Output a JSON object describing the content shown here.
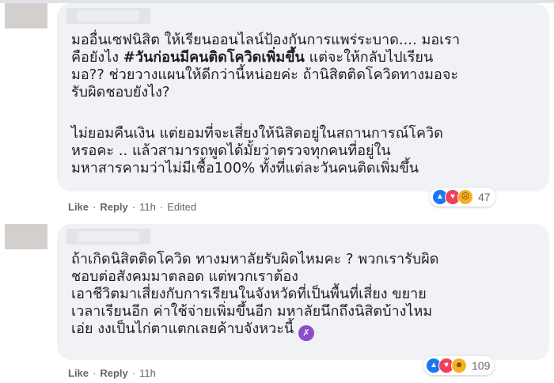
{
  "comments": [
    {
      "author": "",
      "paragraph1": {
        "before": "มออื่นเซฟนิสิต ให้เรียนออนไลน์ป้องกันการแพร่ระบาด.... มอเรา\nคือยังไง ",
        "hashtag": "#วันก่อนมีคนติดโควิดเพิ่มขึ้น",
        "after": " แต่จะให้กลับไปเรียน\nมอ?? ช่วยวางแผนให้ดีกว่านี้หน่อยค่ะ ถ้านิสิตติดโควิดทางมอจะ\nรับผิดชอบยังไง?"
      },
      "paragraph2": "ไม่ยอมคืนเงิน แต่ยอมที่จะเสี่ยงให้นิสิตอยู่ในสถานการณ์โควิด\nหรอคะ .. แล้วสามารถพูดได้มั้ยว่าตรวจทุกคนที่อยู่ใน\nมหาสารคามว่าไม่มีเชื้อ100% ทั้งที่แต่ละวันคนติดเพิ่มขึ้น",
      "reactions": {
        "icons": [
          "like-icon",
          "love-icon",
          "sad-icon"
        ],
        "count": "47"
      },
      "actions": {
        "like": "Like",
        "reply": "Reply",
        "time": "11h",
        "edited": "Edited"
      }
    },
    {
      "author": "",
      "paragraph1": "ถ้าเกิดนิสิตติดโควิด ทางมหาลัยรับผิดไหมคะ ? พวกเรารับผิด\nชอบต่อสังคมมาตลอด แต่พวกเราต้อง\nเอาชีวิตมาเสี่ยงกับการเรียนในจังหวัดที่เป็นพื้นที่เสี่ยง ขยาย\nเวลาเรียนอีก ค่าใช้จ่ายเพิ่มขึ้นอีก มหาลัยนึกถึงนิสิตบ้างไหม\nเอ่ย งงเป็นไก่ตาแตกเลยค้าบจังหวะนี้",
      "emoji": "dizzy-face-emoji",
      "reactions": {
        "icons": [
          "like-icon",
          "love-icon",
          "haha-icon"
        ],
        "count": "109"
      },
      "actions": {
        "like": "Like",
        "reply": "Reply",
        "time": "11h"
      }
    }
  ],
  "colors": {
    "bubble": "#f0f2f5",
    "text": "#1c1e21",
    "meta": "#65676b",
    "like": "#1877f2",
    "love": "#f33e58",
    "yellow": "#f7b125"
  }
}
